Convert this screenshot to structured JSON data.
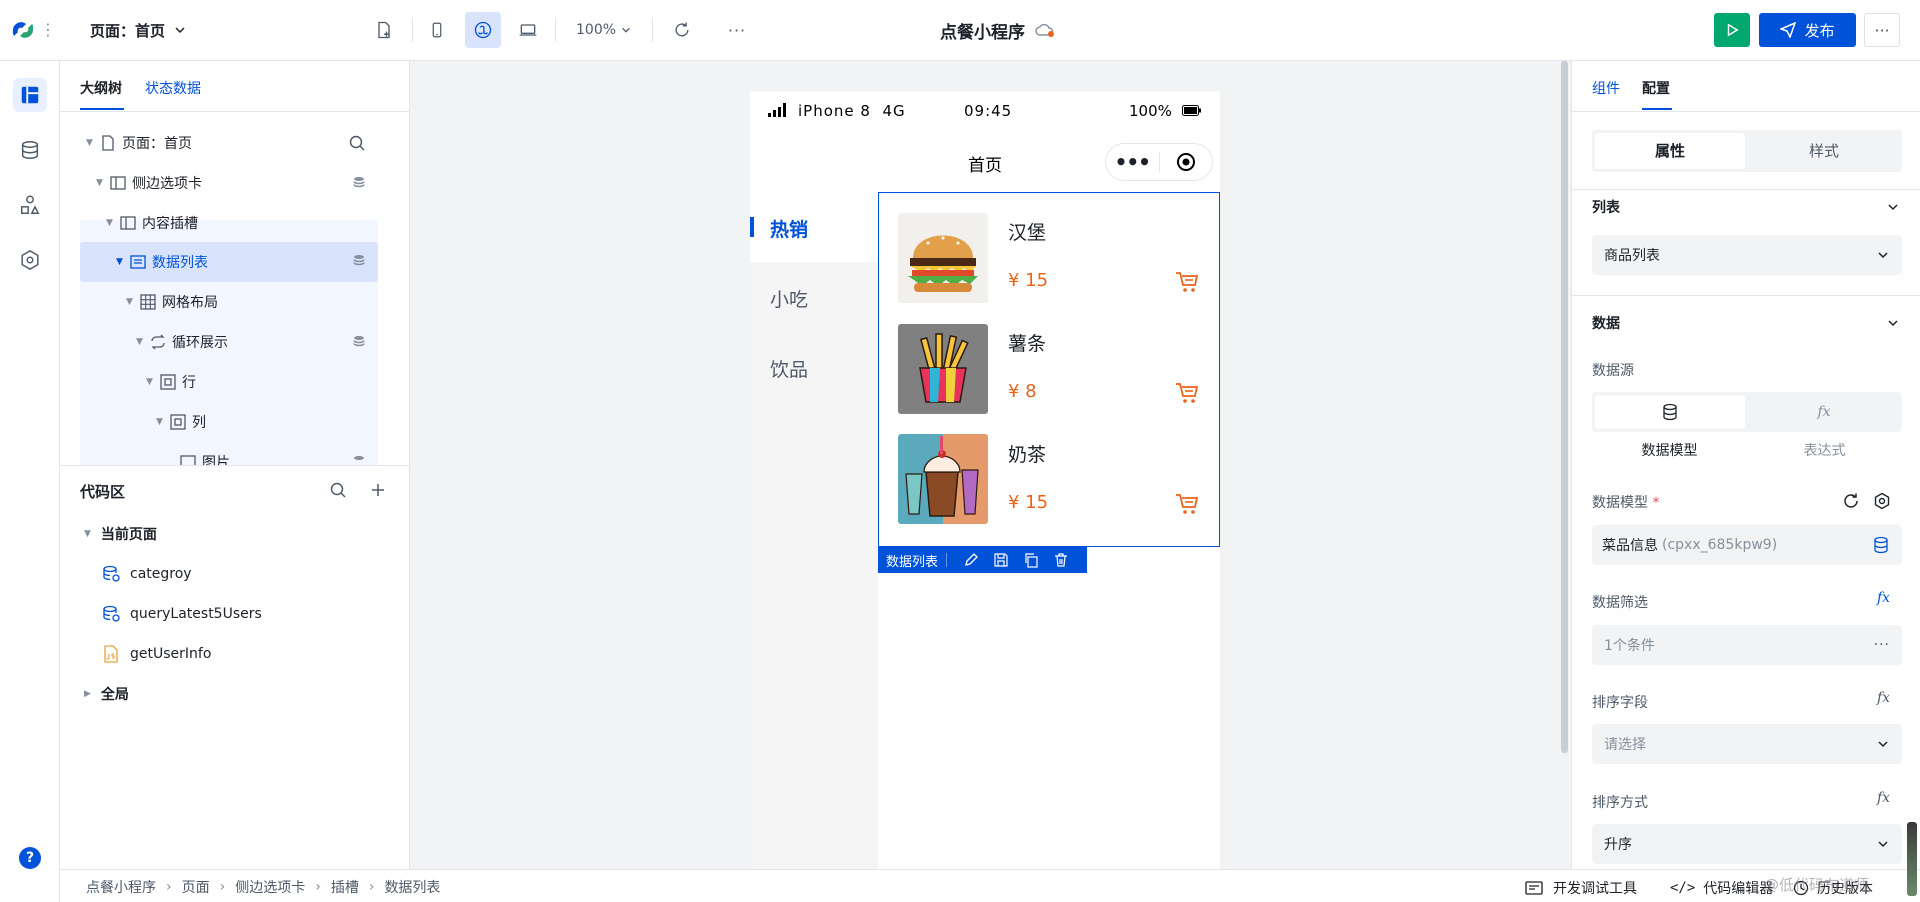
{
  "topbar": {
    "page_selector": "页面：首页",
    "zoom": "100%",
    "app_title": "点餐小程序",
    "publish_label": "发布"
  },
  "left_panel": {
    "tabs": [
      "大纲树",
      "状态数据"
    ],
    "tree": [
      {
        "label": "页面：首页"
      },
      {
        "label": "侧边选项卡"
      },
      {
        "label": "内容插槽"
      },
      {
        "label": "数据列表"
      },
      {
        "label": "网格布局"
      },
      {
        "label": "循环展示"
      },
      {
        "label": "行"
      },
      {
        "label": "列"
      },
      {
        "label": "图片"
      }
    ],
    "code_area": {
      "title": "代码区",
      "current_page": "当前页面",
      "items": [
        "categroy",
        "queryLatest5Users",
        "getUserInfo"
      ],
      "global": "全局"
    }
  },
  "phone": {
    "status": {
      "carrier": "iPhone 8",
      "network": "4G",
      "time": "09:45",
      "battery": "100%"
    },
    "nav_title": "首页",
    "sidebar_tabs": [
      "热销",
      "小吃",
      "饮品"
    ],
    "products": [
      {
        "name": "汉堡",
        "price": "¥ 15"
      },
      {
        "name": "薯条",
        "price": "¥ 8"
      },
      {
        "name": "奶茶",
        "price": "¥ 15"
      }
    ],
    "selection_tag": "数据列表"
  },
  "right_panel": {
    "tabs": [
      "组件",
      "配置"
    ],
    "segment": [
      "属性",
      "样式"
    ],
    "list_section": "列表",
    "list_select": "商品列表",
    "data_section": "数据",
    "data_source_label": "数据源",
    "source_options": [
      "数据模型",
      "表达式"
    ],
    "model_label": "数据模型",
    "model_required": "*",
    "model_value": "菜品信息",
    "model_id": "(cpxx_685kpw9)",
    "filter_label": "数据筛选",
    "filter_value": "1个条件",
    "sort_field_label": "排序字段",
    "sort_field_placeholder": "请选择",
    "sort_order_label": "排序方式",
    "sort_order_value": "升序",
    "fx": "fx"
  },
  "statusbar": {
    "breadcrumb": [
      "点餐小程序",
      "页面",
      "侧边选项卡",
      "插槽",
      "数据列表"
    ],
    "dev_tools": "开发调试工具",
    "code_editor": "代码编辑器",
    "history": "历史版本",
    "watermark": "@低代码布道师"
  },
  "colors": {
    "primary": "#0052d9",
    "price": "#e8641b",
    "selected_row": "#d9e4fc",
    "publish_run": "#00a870"
  }
}
